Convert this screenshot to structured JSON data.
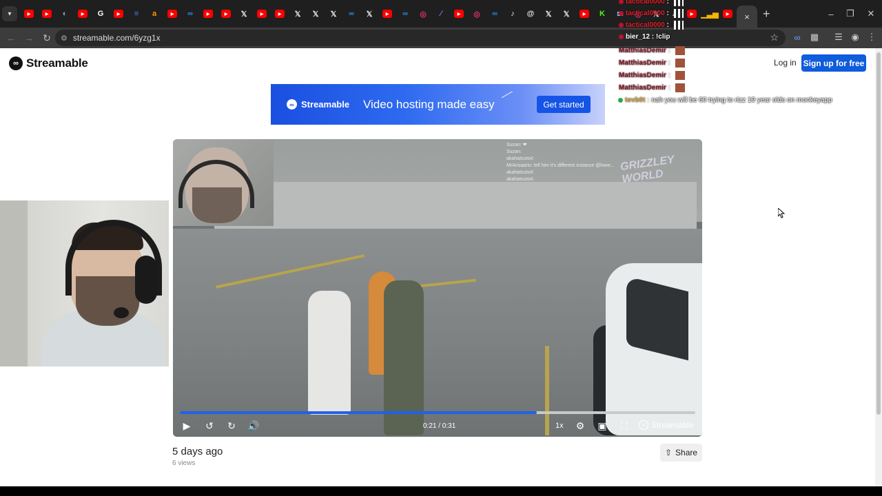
{
  "browser": {
    "tabs": [
      {
        "icon": "youtube-icon",
        "color": "#ff0000"
      },
      {
        "icon": "youtube-icon",
        "color": "#ff0000"
      },
      {
        "icon": "tracker-icon",
        "color": "#9aa0a6"
      },
      {
        "icon": "youtube-icon",
        "color": "#ff0000"
      },
      {
        "icon": "google-icon",
        "color": "#ffffff"
      },
      {
        "icon": "youtube-icon",
        "color": "#ff0000"
      },
      {
        "icon": "docs-icon",
        "color": "#4a7de8"
      },
      {
        "icon": "amazon-icon",
        "color": "#ff9900"
      },
      {
        "icon": "youtube-icon",
        "color": "#ff0000"
      },
      {
        "icon": "streamable-icon",
        "color": "#2b8be8"
      },
      {
        "icon": "youtube-icon",
        "color": "#ff0000"
      },
      {
        "icon": "youtube-icon",
        "color": "#ff0000"
      },
      {
        "icon": "x-icon",
        "color": "#e8e8e8"
      },
      {
        "icon": "youtube-icon",
        "color": "#ff0000"
      },
      {
        "icon": "youtube-icon",
        "color": "#ff0000"
      },
      {
        "icon": "x-icon",
        "color": "#e8e8e8"
      },
      {
        "icon": "x-icon",
        "color": "#e8e8e8"
      },
      {
        "icon": "x-icon",
        "color": "#e8e8e8"
      },
      {
        "icon": "streamable-icon",
        "color": "#2b8be8"
      },
      {
        "icon": "x-icon",
        "color": "#e8e8e8"
      },
      {
        "icon": "youtube-icon",
        "color": "#ff0000"
      },
      {
        "icon": "streamable-icon",
        "color": "#2b8be8"
      },
      {
        "icon": "instagram-icon",
        "color": "#e1306c"
      },
      {
        "icon": "feather-icon",
        "color": "#a070f0"
      },
      {
        "icon": "youtube-icon",
        "color": "#ff0000"
      },
      {
        "icon": "instagram-icon",
        "color": "#e1306c"
      },
      {
        "icon": "streamable-icon",
        "color": "#2b8be8"
      },
      {
        "icon": "tiktok-icon",
        "color": "#e8e8e8"
      },
      {
        "icon": "threads-icon",
        "color": "#e8e8e8"
      },
      {
        "icon": "x-icon",
        "color": "#e8e8e8"
      },
      {
        "icon": "x-icon",
        "color": "#e8e8e8"
      },
      {
        "icon": "youtube-icon",
        "color": "#ff0000"
      },
      {
        "icon": "kick-icon",
        "color": "#53fc18"
      },
      {
        "icon": "email-icon",
        "color": "#8ab4f8"
      },
      {
        "icon": "instagram-icon",
        "color": "#e1306c"
      },
      {
        "icon": "x-icon",
        "color": "#e8e8e8"
      },
      {
        "icon": "tiktok-icon",
        "color": "#e8e8e8"
      },
      {
        "icon": "youtube-icon",
        "color": "#ff0000"
      },
      {
        "icon": "chart-icon",
        "color": "#f4b400"
      },
      {
        "icon": "youtube-icon",
        "color": "#ff0000"
      }
    ],
    "url": "streamable.com/6yzg1x"
  },
  "header": {
    "logo_text": "Streamable",
    "login_label": "Log in",
    "signup_label": "Sign up for free"
  },
  "banner": {
    "logo_text": "Streamable",
    "tagline": "Video hosting made easy",
    "cta_label": "Get started"
  },
  "video": {
    "time_label": "0:21 / 0:31",
    "progress": 0.693,
    "speed_label": "1x",
    "brand_label": "Streamable",
    "ingame_chat": [
      "Suzan: ❤",
      "Suzan:",
      "akahatsuto4:",
      "MrAnsaario: tell him it's different instance @lowe...",
      "akahatsuto4:",
      "akahatsuto4:"
    ],
    "watermark": "GRIZZLEY WORLD"
  },
  "meta": {
    "posted": "5 days ago",
    "views": "6 views",
    "share_label": "Share"
  },
  "stream_chat": [
    {
      "user": "tactical0000",
      "msg": "",
      "color": "#e0202a"
    },
    {
      "user": "tactical0000",
      "msg": "",
      "color": "#e0202a"
    },
    {
      "user": "tactical0000",
      "msg": "",
      "color": "#e0202a"
    },
    {
      "user": "bier_12",
      "msg": "!clip",
      "color": "#ffffff"
    },
    {
      "user": "MatthiasDemir",
      "msg": "",
      "color": "#8b1a2a"
    },
    {
      "user": "MatthiasDemir",
      "msg": "",
      "color": "#8b1a2a"
    },
    {
      "user": "MatthiasDemir",
      "msg": "",
      "color": "#8b1a2a"
    },
    {
      "user": "MatthiasDemir",
      "msg": "",
      "color": "#8b1a2a"
    },
    {
      "user": "tevb0t",
      "msg": "nah you will be 60 trying to rizz 19 year olds on monkeyapp",
      "color": "#d4a84a"
    }
  ]
}
